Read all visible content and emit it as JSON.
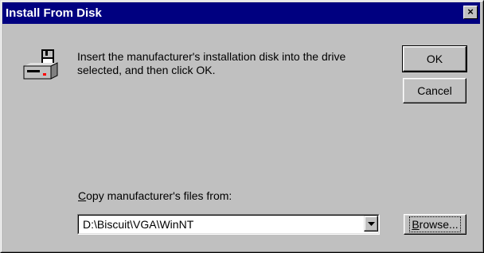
{
  "dialog": {
    "title": "Install From Disk",
    "close_label": "×",
    "message": "Insert the manufacturer's installation disk into the drive\nselected, and then click OK.",
    "icon": "floppy-drive-icon"
  },
  "buttons": {
    "ok_label": "OK",
    "cancel_label": "Cancel",
    "browse_label": "Browse..."
  },
  "copy_from": {
    "label": "Copy manufacturer's files from:",
    "value": "D:\\Biscuit\\VGA\\WinNT"
  },
  "colors": {
    "titlebar": "#000080",
    "face": "#c0c0c0"
  }
}
